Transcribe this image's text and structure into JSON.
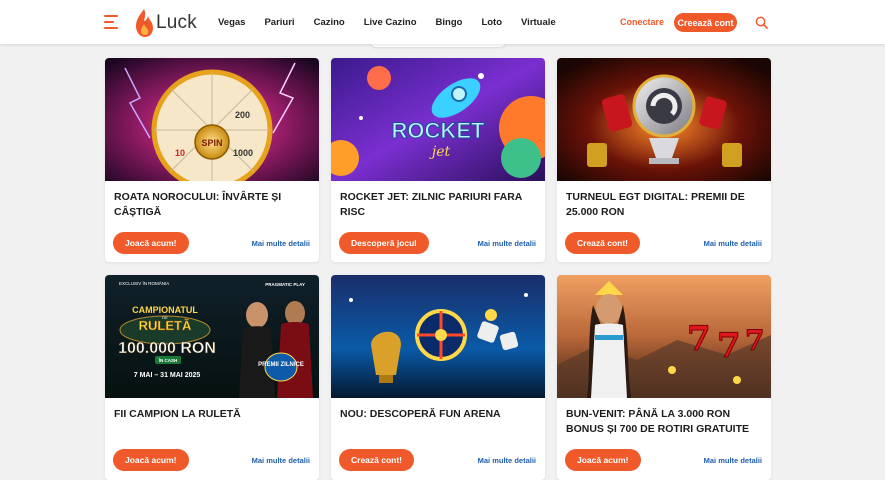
{
  "brand": {
    "name": "Luck",
    "accent": "#f05a2a",
    "link_color": "#1f5fae"
  },
  "header": {
    "nav": [
      "Vegas",
      "Pariuri",
      "Cazino",
      "Live Cazino",
      "Bingo",
      "Loto",
      "Virtuale"
    ],
    "login": "Conectare",
    "signup": "Creează cont",
    "icons": [
      "hamburger-menu-icon",
      "flame-logo-icon",
      "search-icon"
    ]
  },
  "cards": [
    {
      "title": "ROATA NOROCULUI: ÎNVÂRTE ȘI CÂȘTIGĂ",
      "button": "Joacă acum!",
      "more": "Mai multe detalii",
      "image_text": [
        "SPIN"
      ]
    },
    {
      "title": "ROCKET JET: ZILNIC PARIURI FARA RISC",
      "button": "Descoperă jocul",
      "more": "Mai multe detalii",
      "image_text": [
        "ROCKET",
        "jet"
      ]
    },
    {
      "title": "TURNEUL EGT DIGITAL: PREMII DE 25.000 RON",
      "button": "Crează cont!",
      "more": "Mai multe detalii",
      "image_text": []
    },
    {
      "title": "FII CAMPION LA RULETĂ",
      "button": "Joacă acum!",
      "more": "Mai multe detalii",
      "image_text": [
        "EXCLUSIV ÎN ROMÂNIA",
        "PRAGMATIC PLAY",
        "CAMPIONATUL",
        "DE",
        "RULETĂ",
        "100.000 RON",
        "ÎN CASH",
        "7 MAI – 31 MAI 2025",
        "PREMII ZILNICE"
      ]
    },
    {
      "title": "NOU: DESCOPERĂ FUN ARENA",
      "button": "Crează cont!",
      "more": "Mai multe detalii",
      "image_text": []
    },
    {
      "title": "BUN-VENIT: PÂNĂ LA 3.000 RON BONUS ȘI 700 DE ROTIRI GRATUITE",
      "button": "Joacă acum!",
      "more": "Mai multe detalii",
      "image_text": []
    }
  ]
}
